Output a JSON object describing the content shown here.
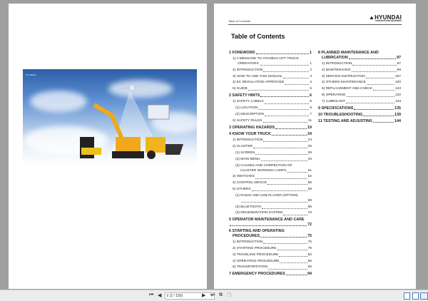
{
  "header": {
    "section": "Table of Contents",
    "brand": "HYUNDAI",
    "brand_sub": "CONSTRUCTION EQUIPMENT"
  },
  "cover": {
    "logo": "HYUNDAI"
  },
  "toc_title": "Table of Contents",
  "left_entries": [
    {
      "level": 0,
      "bold": true,
      "lines": [
        "1 FOREWORD"
      ],
      "page": "1"
    },
    {
      "level": 1,
      "lines": [
        "1) A MESSAGE TO HYUNDAI LIFT TRUCK",
        "OPERATORS"
      ],
      "page": "1"
    },
    {
      "level": 1,
      "lines": [
        "2) INTRODUCTION"
      ],
      "page": "2"
    },
    {
      "level": 1,
      "lines": [
        "3) HOW TO USE THIS MANUAL"
      ],
      "page": "3"
    },
    {
      "level": 1,
      "lines": [
        "4) EC REGULATION APPROVED"
      ],
      "page": "4"
    },
    {
      "level": 1,
      "lines": [
        "5) GUIDE"
      ],
      "page": "5"
    },
    {
      "level": 0,
      "bold": true,
      "lines": [
        "2 SAFETY HINTS"
      ],
      "page": "6"
    },
    {
      "level": 1,
      "lines": [
        "1) SAFETY LABELS"
      ],
      "page": "6"
    },
    {
      "level": 2,
      "lines": [
        "(1) LOCATION"
      ],
      "page": "6"
    },
    {
      "level": 2,
      "lines": [
        "(2) DESCRIPTION"
      ],
      "page": "7"
    },
    {
      "level": 1,
      "lines": [
        "2) SAFETY RULES"
      ],
      "page": "11"
    },
    {
      "level": 0,
      "bold": true,
      "lines": [
        "3 OPERATING HAZARDS"
      ],
      "page": "19"
    },
    {
      "level": 0,
      "bold": true,
      "lines": [
        "4 KNOW YOUR TRUCK"
      ],
      "page": "24"
    },
    {
      "level": 1,
      "lines": [
        "1) INTRODUCTION"
      ],
      "page": "24"
    },
    {
      "level": 1,
      "lines": [
        "2) CLUSTER"
      ],
      "page": "26"
    },
    {
      "level": 2,
      "lines": [
        "(1) SCREEN"
      ],
      "page": "26"
    },
    {
      "level": 2,
      "lines": [
        "(2) MAIN MENU"
      ],
      "page": "33"
    },
    {
      "level": 2,
      "lines": [
        "(3) CAUSES AND CORRECTION OF",
        "CLUSTER WARNING LAMPS"
      ],
      "page": "51"
    },
    {
      "level": 1,
      "lines": [
        "3) SWITCHES"
      ],
      "page": "52"
    },
    {
      "level": 1,
      "lines": [
        "4) CONTROL DEVICE"
      ],
      "page": "55"
    },
    {
      "level": 1,
      "lines": [
        "5) OTHERS"
      ],
      "page": "59"
    },
    {
      "level": 2,
      "lines": [
        "(1) RADIO AND USB PLAYER (OPTION)",
        ""
      ],
      "page": "59"
    },
    {
      "level": 2,
      "lines": [
        "(2) BLUETOOTH"
      ],
      "page": "65"
    },
    {
      "level": 2,
      "lines": [
        "(3) REGENERATION SYSTEM"
      ],
      "page": "70"
    },
    {
      "level": 0,
      "bold": true,
      "lines": [
        "5 OPERATOR MAINTENANCE AND CARE",
        ""
      ],
      "page": "72"
    },
    {
      "level": 0,
      "bold": true,
      "lines": [
        "6 STARTING AND OPERATING",
        "PROCEDURES"
      ],
      "page": "75"
    },
    {
      "level": 1,
      "lines": [
        "1) INTRODUCTION"
      ],
      "page": "75"
    },
    {
      "level": 1,
      "lines": [
        "2) STARTING PROCEDURE"
      ],
      "page": "79"
    },
    {
      "level": 1,
      "lines": [
        "3) TRAVELING PROCEDURE"
      ],
      "page": "82"
    },
    {
      "level": 1,
      "lines": [
        "4) OPERATING PROCEDURE"
      ],
      "page": "86"
    },
    {
      "level": 1,
      "lines": [
        "5) TRANSPORTATION"
      ],
      "page": "92"
    },
    {
      "level": 0,
      "bold": true,
      "lines": [
        "7 EMERGENCY PROCEDURES"
      ],
      "page": "94"
    }
  ],
  "right_entries": [
    {
      "level": 0,
      "bold": true,
      "lines": [
        "8 PLANNED MAINTENANCE AND",
        "LUBRICATION"
      ],
      "page": "97"
    },
    {
      "level": 1,
      "lines": [
        "1) INTRODUCTION"
      ],
      "page": "97"
    },
    {
      "level": 1,
      "lines": [
        "2) MAINTENANCE"
      ],
      "page": "99"
    },
    {
      "level": 1,
      "lines": [
        "3) SERVICE INSTRUCTION"
      ],
      "page": "107"
    },
    {
      "level": 1,
      "lines": [
        "4) OTHERS MAINTENANCE"
      ],
      "page": "120"
    },
    {
      "level": 1,
      "lines": [
        "5) REPLACEMENT AND CHECK"
      ],
      "page": "123"
    },
    {
      "level": 1,
      "lines": [
        "6) OPERATING"
      ],
      "page": "132"
    },
    {
      "level": 1,
      "lines": [
        "7) LUBRICANT"
      ],
      "page": "133"
    },
    {
      "level": 0,
      "bold": true,
      "lines": [
        "9 SPECIFICATIONS"
      ],
      "page": "135"
    },
    {
      "level": 0,
      "bold": true,
      "lines": [
        "10 TROUBLESHOOTING"
      ],
      "page": "139"
    },
    {
      "level": 0,
      "bold": true,
      "lines": [
        "11 TESTING AND ADJUSTING"
      ],
      "page": "144"
    }
  ],
  "toolbar": {
    "page_indicator": "ii (2 / 150)",
    "icons": [
      "first-page-icon",
      "prev-page-icon",
      "next-page-icon",
      "last-page-icon",
      "copy-icon",
      "paste-icon",
      "single-page-icon",
      "continuous-icon",
      "two-page-icon"
    ]
  }
}
